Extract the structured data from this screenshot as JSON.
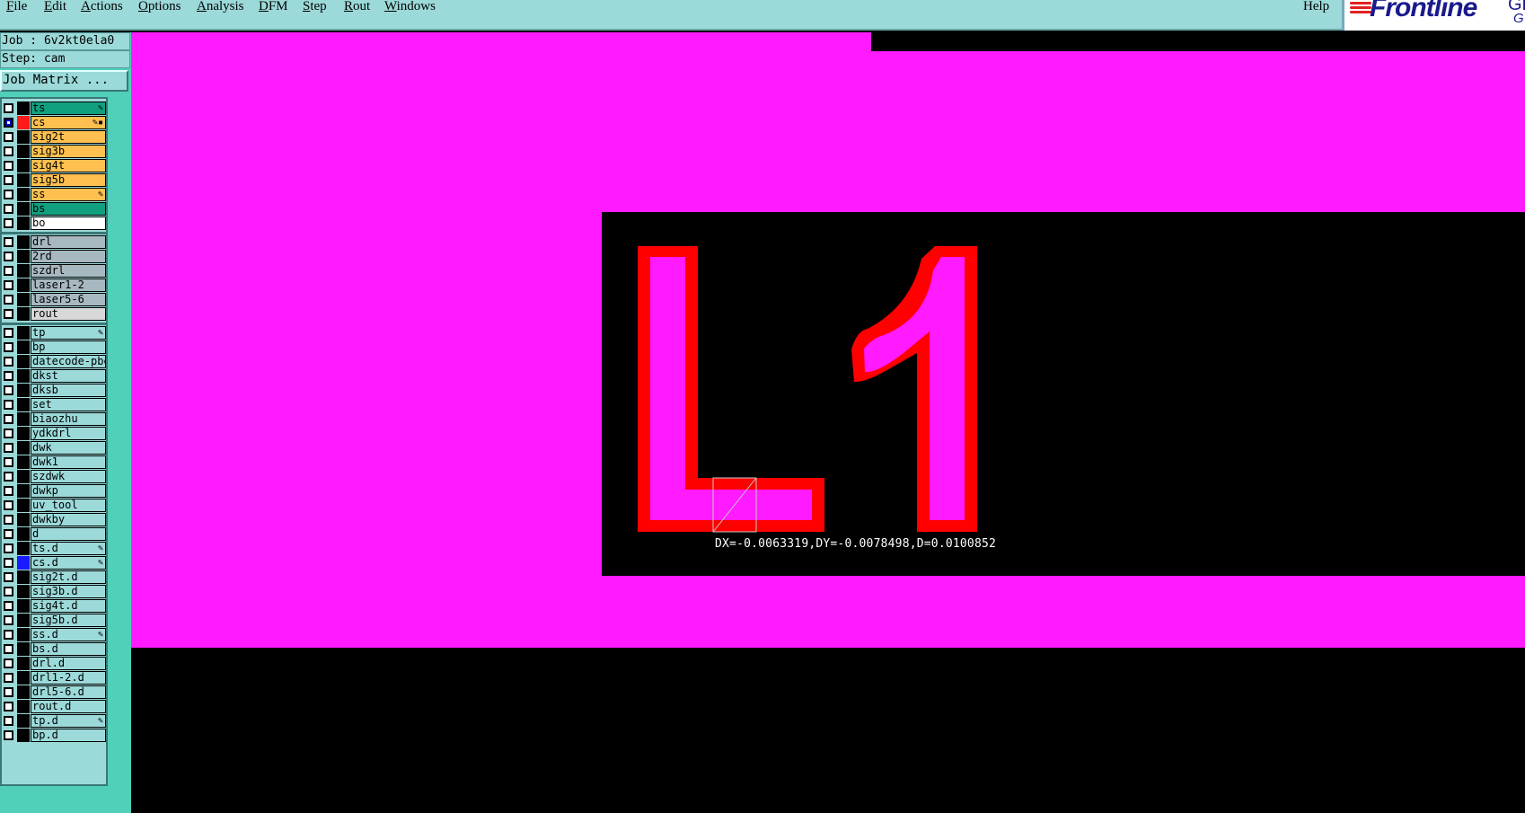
{
  "menu": [
    {
      "label": "File",
      "underline": "F",
      "rest": "ile"
    },
    {
      "label": "Edit",
      "underline": "E",
      "rest": "dit"
    },
    {
      "label": "Actions",
      "underline": "A",
      "rest": "ctions"
    },
    {
      "label": "Options",
      "underline": "O",
      "rest": "ptions"
    },
    {
      "label": "Analysis",
      "underline": "A",
      "rest": "nalysis"
    },
    {
      "label": "DFM",
      "underline": "D",
      "rest": "FM"
    },
    {
      "label": "Step",
      "underline": "S",
      "rest": "tep"
    },
    {
      "label": "Rout",
      "underline": "R",
      "rest": "out"
    },
    {
      "label": "Windows",
      "underline": "W",
      "rest": "indows"
    }
  ],
  "help_label": "Help",
  "logo": {
    "text": "Frontline",
    "cut1": "GE",
    "cut2": "G"
  },
  "job_label": "Job : 6v2kt0ela0",
  "step_label": "Step: cam",
  "job_matrix_label": "Job Matrix ...",
  "layers": [
    {
      "name": "ts",
      "color": "#10a080",
      "mark": "✎",
      "checked": false,
      "swatch": "#000000"
    },
    {
      "name": "cs",
      "color": "#ffc050",
      "mark": "✎▪",
      "checked": true,
      "swatch": "#ff1a1a"
    },
    {
      "name": "sig2t",
      "color": "#ffc050",
      "mark": "",
      "checked": false,
      "swatch": "#000000"
    },
    {
      "name": "sig3b",
      "color": "#ffc050",
      "mark": "",
      "checked": false,
      "swatch": "#000000"
    },
    {
      "name": "sig4t",
      "color": "#ffc050",
      "mark": "",
      "checked": false,
      "swatch": "#000000"
    },
    {
      "name": "sig5b",
      "color": "#ffc050",
      "mark": "",
      "checked": false,
      "swatch": "#000000"
    },
    {
      "name": "ss",
      "color": "#ffc050",
      "mark": "✎",
      "checked": false,
      "swatch": "#000000"
    },
    {
      "name": "bs",
      "color": "#10a080",
      "mark": "",
      "checked": false,
      "swatch": "#000000"
    },
    {
      "name": "bo",
      "color": "#ffffff",
      "mark": "",
      "checked": false,
      "swatch": "#000000"
    },
    {
      "name": "drl",
      "color": "#a8b8c0",
      "mark": "",
      "checked": false,
      "swatch": "#000000"
    },
    {
      "name": "2rd",
      "color": "#a8b8c0",
      "mark": "",
      "checked": false,
      "swatch": "#000000"
    },
    {
      "name": "szdrl",
      "color": "#a8b8c0",
      "mark": "",
      "checked": false,
      "swatch": "#000000"
    },
    {
      "name": "laser1-2",
      "color": "#a8b8c0",
      "mark": "",
      "checked": false,
      "swatch": "#000000"
    },
    {
      "name": "laser5-6",
      "color": "#a8b8c0",
      "mark": "",
      "checked": false,
      "swatch": "#000000"
    },
    {
      "name": "rout",
      "color": "#d8d8d8",
      "mark": "",
      "checked": false,
      "swatch": "#000000"
    },
    {
      "name": "tp",
      "color": "#9cd9d9",
      "mark": "✎",
      "checked": false,
      "swatch": "#000000"
    },
    {
      "name": "bp",
      "color": "#9cd9d9",
      "mark": "",
      "checked": false,
      "swatch": "#000000"
    },
    {
      "name": "datecode-pbe",
      "color": "#9cd9d9",
      "mark": "",
      "checked": false,
      "swatch": "#000000"
    },
    {
      "name": "dkst",
      "color": "#9cd9d9",
      "mark": "",
      "checked": false,
      "swatch": "#000000"
    },
    {
      "name": "dksb",
      "color": "#9cd9d9",
      "mark": "",
      "checked": false,
      "swatch": "#000000"
    },
    {
      "name": "set",
      "color": "#9cd9d9",
      "mark": "",
      "checked": false,
      "swatch": "#000000"
    },
    {
      "name": "biaozhu",
      "color": "#9cd9d9",
      "mark": "",
      "checked": false,
      "swatch": "#000000"
    },
    {
      "name": "ydkdrl",
      "color": "#9cd9d9",
      "mark": "",
      "checked": false,
      "swatch": "#000000"
    },
    {
      "name": "dwk",
      "color": "#9cd9d9",
      "mark": "",
      "checked": false,
      "swatch": "#000000"
    },
    {
      "name": "dwk1",
      "color": "#9cd9d9",
      "mark": "",
      "checked": false,
      "swatch": "#000000"
    },
    {
      "name": "szdwk",
      "color": "#9cd9d9",
      "mark": "",
      "checked": false,
      "swatch": "#000000"
    },
    {
      "name": "dwkp",
      "color": "#9cd9d9",
      "mark": "",
      "checked": false,
      "swatch": "#000000"
    },
    {
      "name": "uv_tool",
      "color": "#9cd9d9",
      "mark": "",
      "checked": false,
      "swatch": "#000000"
    },
    {
      "name": "dwkby",
      "color": "#9cd9d9",
      "mark": "",
      "checked": false,
      "swatch": "#000000"
    },
    {
      "name": "d",
      "color": "#9cd9d9",
      "mark": "",
      "checked": false,
      "swatch": "#000000"
    },
    {
      "name": "ts.d",
      "color": "#9cd9d9",
      "mark": "✎",
      "checked": false,
      "swatch": "#000000"
    },
    {
      "name": "cs.d",
      "color": "#9cd9d9",
      "mark": "✎",
      "checked": false,
      "swatch": "#1a1aff"
    },
    {
      "name": "sig2t.d",
      "color": "#9cd9d9",
      "mark": "",
      "checked": false,
      "swatch": "#000000"
    },
    {
      "name": "sig3b.d",
      "color": "#9cd9d9",
      "mark": "",
      "checked": false,
      "swatch": "#000000"
    },
    {
      "name": "sig4t.d",
      "color": "#9cd9d9",
      "mark": "",
      "checked": false,
      "swatch": "#000000"
    },
    {
      "name": "sig5b.d",
      "color": "#9cd9d9",
      "mark": "",
      "checked": false,
      "swatch": "#000000"
    },
    {
      "name": "ss.d",
      "color": "#9cd9d9",
      "mark": "✎",
      "checked": false,
      "swatch": "#000000"
    },
    {
      "name": "bs.d",
      "color": "#9cd9d9",
      "mark": "",
      "checked": false,
      "swatch": "#000000"
    },
    {
      "name": "drl.d",
      "color": "#9cd9d9",
      "mark": "",
      "checked": false,
      "swatch": "#000000"
    },
    {
      "name": "drl1-2.d",
      "color": "#9cd9d9",
      "mark": "",
      "checked": false,
      "swatch": "#000000"
    },
    {
      "name": "drl5-6.d",
      "color": "#9cd9d9",
      "mark": "",
      "checked": false,
      "swatch": "#000000"
    },
    {
      "name": "rout.d",
      "color": "#9cd9d9",
      "mark": "",
      "checked": false,
      "swatch": "#000000"
    },
    {
      "name": "tp.d",
      "color": "#9cd9d9",
      "mark": "✎",
      "checked": false,
      "swatch": "#000000"
    },
    {
      "name": "bp.d",
      "color": "#9cd9d9",
      "mark": "",
      "checked": false,
      "swatch": "#000000"
    }
  ],
  "canvas": {
    "copper_color": "#ff1aff",
    "outline_color": "#ff0000",
    "text": "L1",
    "measure_readout": "DX=-0.0063319,DY=-0.0078498,D=0.0100852"
  }
}
